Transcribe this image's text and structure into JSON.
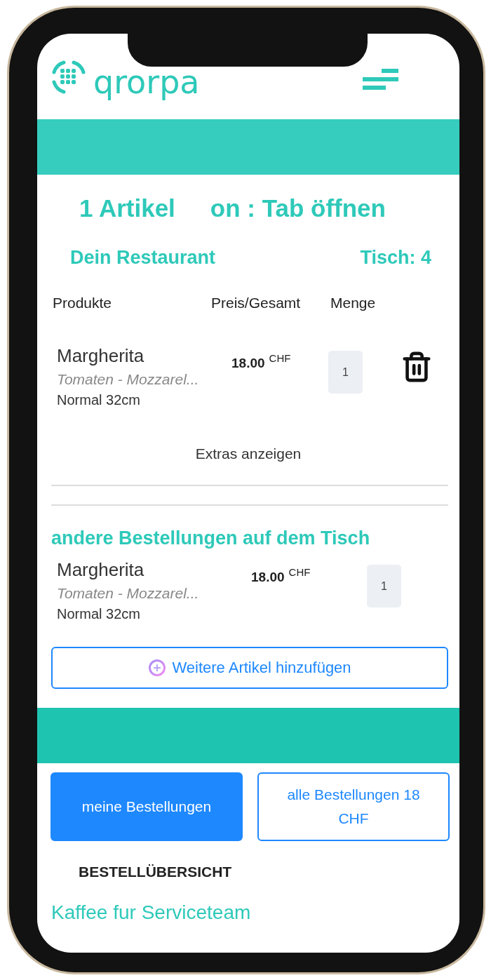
{
  "header": {
    "logo": "qrorpa"
  },
  "summary": {
    "article_count": "1 Artikel",
    "tab_action": "on : Tab öffnen"
  },
  "restaurant": {
    "name": "Dein Restaurant",
    "table": "Tisch: 4"
  },
  "columns": [
    "Produkte",
    "Preis/Gesamt",
    "Menge"
  ],
  "my_items": [
    {
      "name": "Margherita",
      "description": "Tomaten - Mozzarel...",
      "size": "Normal 32cm",
      "price": "18.00",
      "currency": "CHF",
      "quantity": "1",
      "deletable": true
    }
  ],
  "extras_link": "Extras anzeigen",
  "other_orders": {
    "title": "andere Bestellungen auf dem Tisch",
    "items": [
      {
        "name": "Margherita",
        "description": "Tomaten - Mozzarel...",
        "size": "Normal 32cm",
        "price": "18.00",
        "currency": "CHF",
        "quantity": "1",
        "deletable": false
      }
    ]
  },
  "add_button": "Weitere Artikel hinzufügen",
  "order_tabs": [
    {
      "label": "meine Bestellungen",
      "selected": true
    },
    {
      "label": "alle Bestellungen 18 CHF",
      "selected": false
    }
  ],
  "overview_title": "BESTELLÜBERSICHT",
  "section_heading": "Kaffee fur Serviceteam"
}
